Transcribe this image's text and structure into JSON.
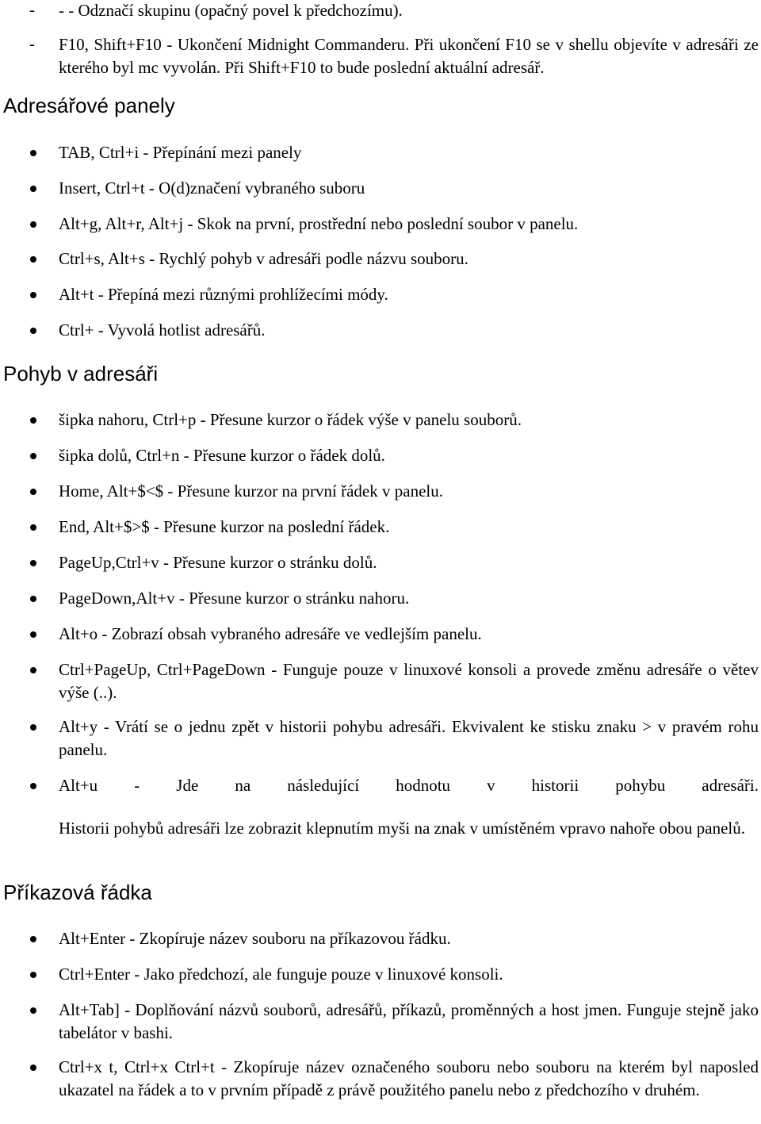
{
  "intro_items": [
    {
      "marker": "-",
      "text": "- - Odznačí skupinu (opačný povel k předchozímu)."
    },
    {
      "marker": "-",
      "text": "F10, Shift+F10 - Ukončení Midnight Commanderu. Při ukončení F10 se v shellu objevíte v adresáři ze kterého byl mc vyvolán. Při Shift+F10 to bude poslední aktuální adresář."
    }
  ],
  "sections": [
    {
      "title": "Adresářové panely",
      "items": [
        "TAB, Ctrl+i - Přepínání mezi panely",
        "Insert, Ctrl+t - O(d)značení vybraného suboru",
        "Alt+g, Alt+r, Alt+j - Skok na první, prostřední nebo poslední soubor v panelu.",
        "Ctrl+s, Alt+s - Rychlý pohyb v adresáři podle názvu souboru.",
        "Alt+t - Přepíná mezi různými prohlížecími módy.",
        "Ctrl+ - Vyvolá hotlist adresářů."
      ]
    },
    {
      "title": "Pohyb v adresáři",
      "items": [
        "šipka nahoru, Ctrl+p - Přesune kurzor o řádek výše v panelu souborů.",
        "šipka dolů, Ctrl+n - Přesune kurzor o řádek dolů.",
        "Home, Alt+$<$ - Přesune kurzor na první řádek v panelu.",
        "End, Alt+$>$ - Přesune kurzor na poslední řádek.",
        "PageUp,Ctrl+v - Přesune kurzor o stránku dolů.",
        "PageDown,Alt+v - Přesune kurzor o stránku nahoru.",
        "Alt+o - Zobrazí obsah vybraného adresáře ve vedlejším panelu.",
        "Ctrl+PageUp, Ctrl+PageDown - Funguje pouze v linuxové konsoli a provede změnu adresáře o větev výše (..).",
        "Alt+y - Vrátí se o jednu zpět v historii pohybu adresáři. Ekvivalent ke stisku znaku > v pravém rohu panelu.",
        "Alt+u - Jde na následující hodnotu v historii pohybu adresáři."
      ],
      "note": "Historii pohybů adresáři lze zobrazit klepnutím myši na znak v umístěném vpravo nahoře obou panelů."
    },
    {
      "title": "Příkazová řádka",
      "items": [
        "Alt+Enter - Zkopíruje název souboru na příkazovou řádku.",
        "Ctrl+Enter - Jako předchozí, ale funguje pouze v linuxové konsoli.",
        "Alt+Tab] - Doplňování názvů souborů, adresářů, příkazů, proměnných a host jmen. Funguje stejně jako tabelátor v bashi.",
        "Ctrl+x t, Ctrl+x Ctrl+t - Zkopíruje název označeného souboru nebo souboru na kterém byl naposled ukazatel na řádek a to v prvním případě z právě použitého panelu nebo z předchozího v druhém."
      ]
    }
  ]
}
